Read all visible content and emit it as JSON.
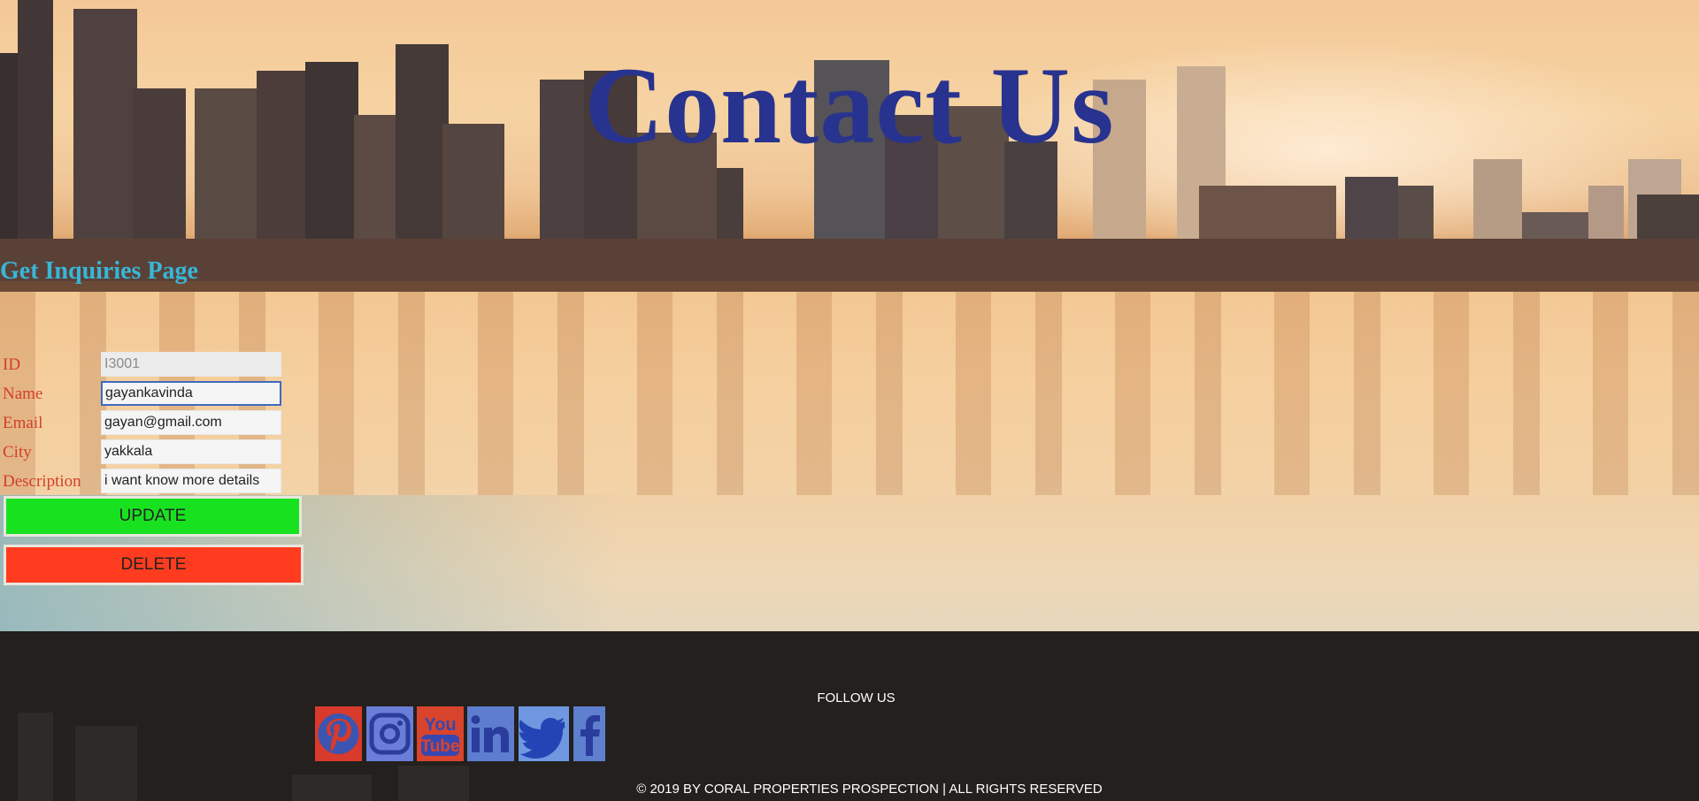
{
  "header": {
    "title": "Contact Us",
    "subtitle": "Get Inquiries Page"
  },
  "form": {
    "fields": [
      {
        "label": "ID",
        "value": "I3001"
      },
      {
        "label": "Name",
        "value": "gayankavinda"
      },
      {
        "label": "Email",
        "value": "gayan@gmail.com"
      },
      {
        "label": "City",
        "value": "yakkala"
      },
      {
        "label": "Description",
        "value": "i want know more details"
      }
    ],
    "update_label": "UPDATE",
    "delete_label": "DELETE"
  },
  "footer": {
    "follow_label": "FOLLOW US",
    "social": [
      {
        "name": "pinterest-icon",
        "color": "#e60023"
      },
      {
        "name": "instagram-icon",
        "color": "#3b57a8"
      },
      {
        "name": "youtube-icon",
        "color": "#e62117"
      },
      {
        "name": "linkedin-icon",
        "color": "#2f6fb5"
      },
      {
        "name": "twitter-icon",
        "color": "#1da1f2"
      },
      {
        "name": "facebook-icon",
        "color": "#3b5998"
      }
    ],
    "youtube_text": "You Tube",
    "copyright": "© 2019 BY CORAL PROPERTIES PROSPECTION | ALL RIGHTS RESERVED"
  },
  "colors": {
    "title": "#28338f",
    "subtitle": "#39b6d8",
    "label": "#d33f2a",
    "update": "#18e21f",
    "delete": "#ff3c1f",
    "footer_bg": "#23201d"
  }
}
